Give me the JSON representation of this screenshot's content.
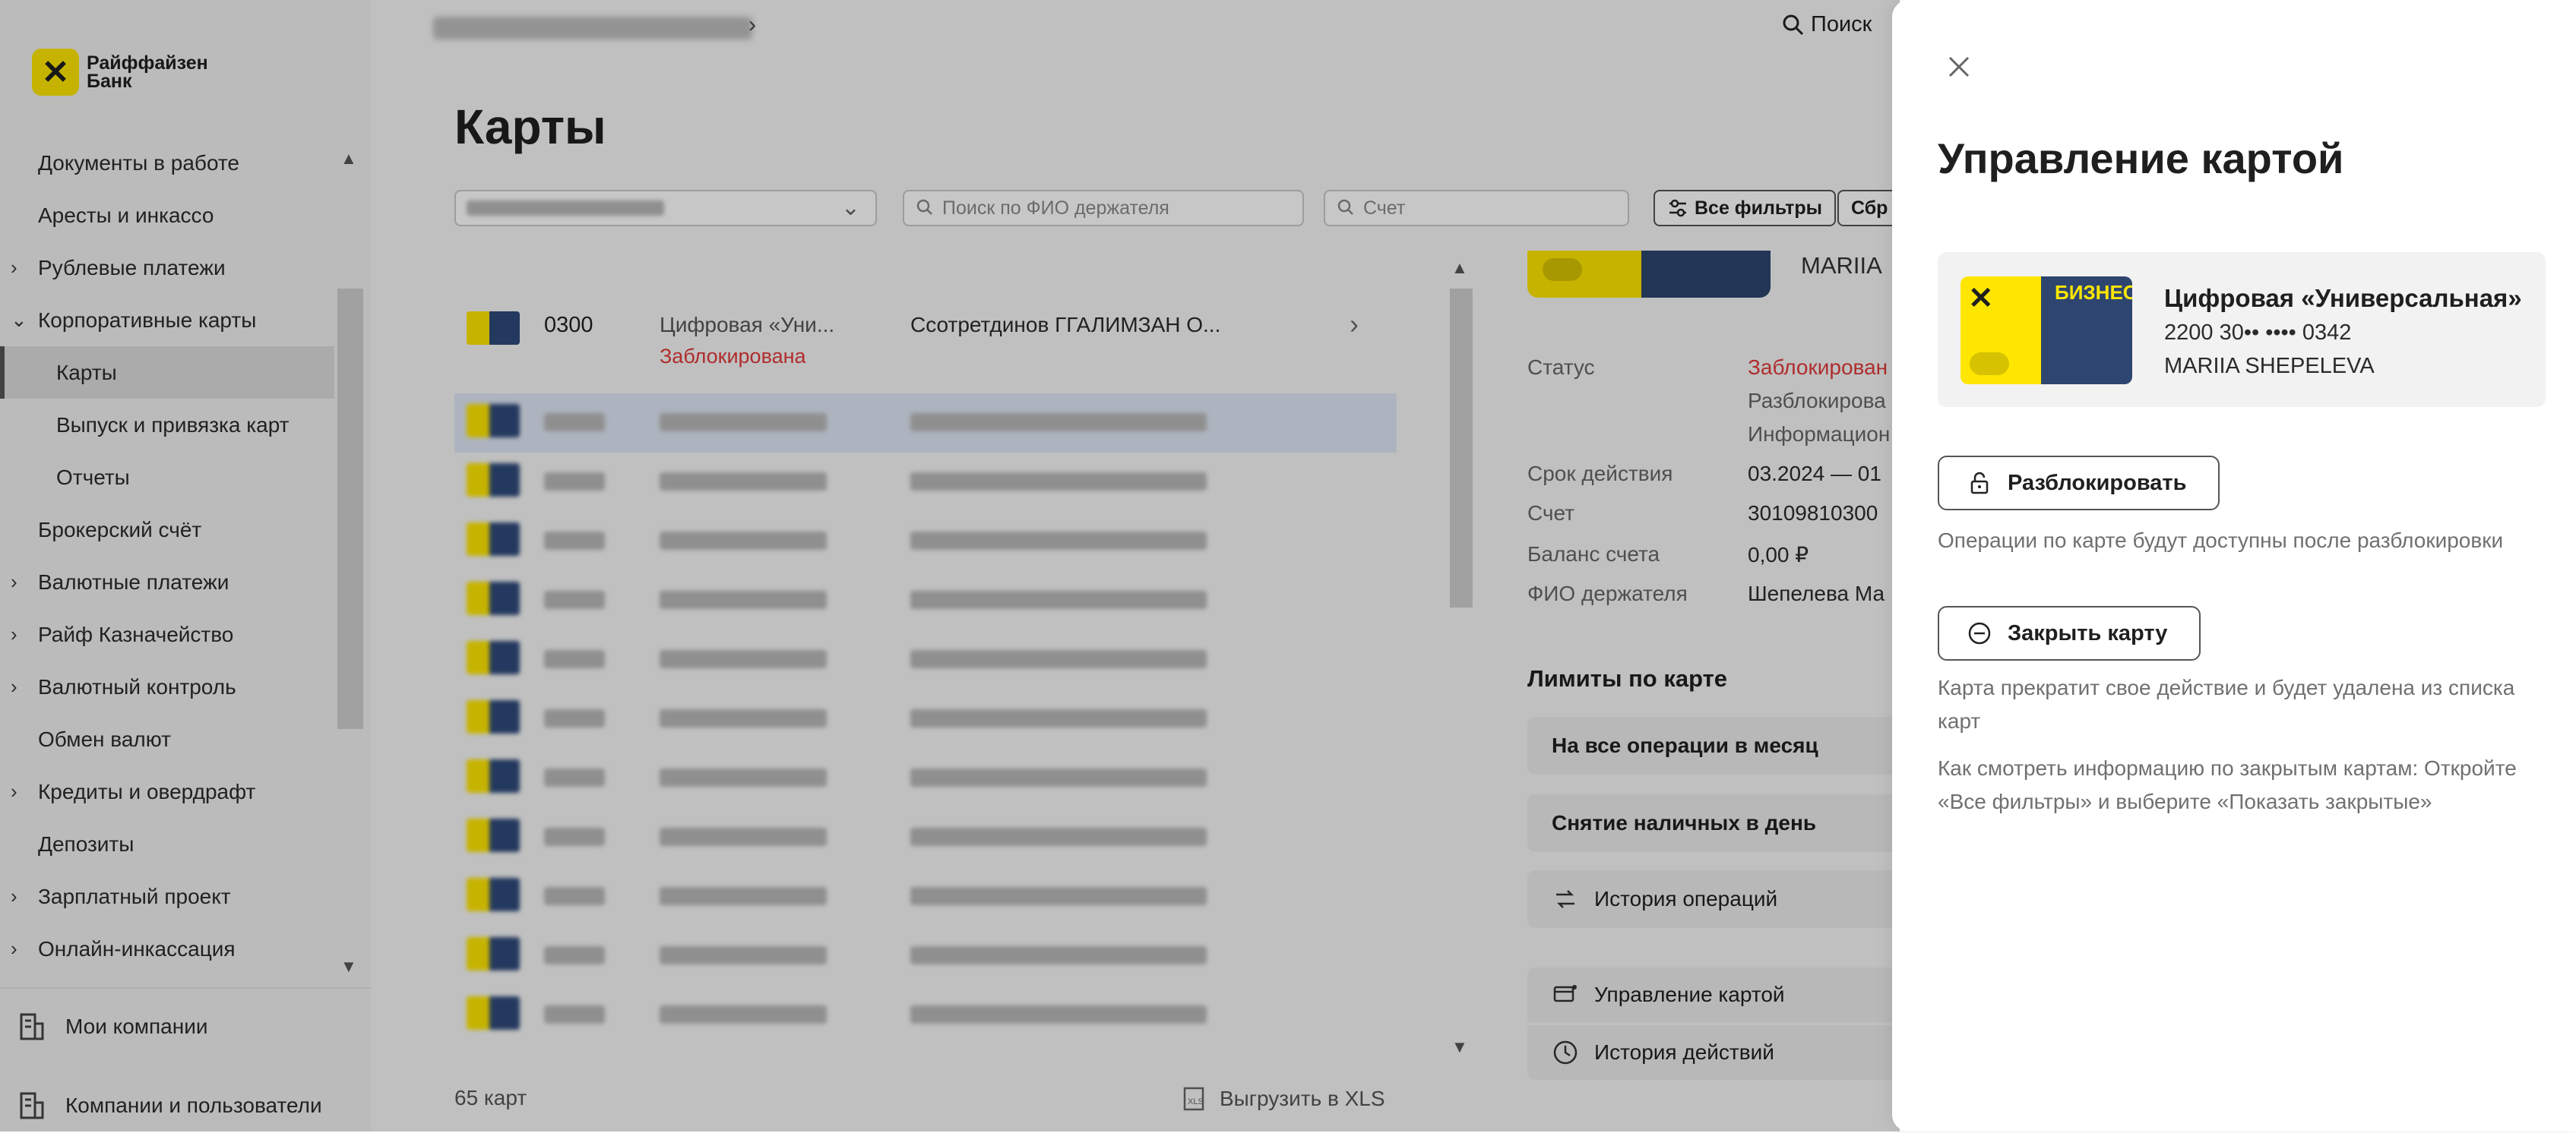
{
  "sidebar": {
    "logo_text": "Райффайзен Банк",
    "items": [
      {
        "label": "Документы в работе",
        "chevron": ""
      },
      {
        "label": "Аресты и инкассо",
        "chevron": ""
      },
      {
        "label": "Рублевые платежи",
        "chevron": "›"
      },
      {
        "label": "Корпоративные карты",
        "chevron": "⌄"
      },
      {
        "label": "Карты",
        "chevron": ""
      },
      {
        "label": "Выпуск и привязка карт",
        "chevron": ""
      },
      {
        "label": "Отчеты",
        "chevron": ""
      },
      {
        "label": "Брокерский счёт",
        "chevron": ""
      },
      {
        "label": "Валютные платежи",
        "chevron": "›"
      },
      {
        "label": "Райф Казначейство",
        "chevron": "›"
      },
      {
        "label": "Валютный контроль",
        "chevron": "›"
      },
      {
        "label": "Обмен валют",
        "chevron": ""
      },
      {
        "label": "Кредиты и овердрафт",
        "chevron": "›"
      },
      {
        "label": "Депозиты",
        "chevron": ""
      },
      {
        "label": "Зарплатный проект",
        "chevron": "›"
      },
      {
        "label": "Онлайн-инкассация",
        "chevron": "›"
      }
    ],
    "bottom": {
      "companies": "Мои компании",
      "users": "Компании и пользователи"
    }
  },
  "header": {
    "search_label": "Поиск"
  },
  "page": {
    "title": "Карты",
    "filters": {
      "holder_placeholder": "Поиск по ФИО держателя",
      "account_placeholder": "Счет",
      "all_filters": "Все фильтры",
      "reset": "Сбр"
    },
    "first_row": {
      "num": "0300",
      "name": "Цифровая «Уни...",
      "status": "Заблокирована",
      "holder": "Ссотретдинов ГГАЛИМЗАН О..."
    },
    "footer_count": "65 карт",
    "export_label": "Выгрузить в XLS"
  },
  "detail": {
    "holder_name": "MARIIA",
    "rows": [
      {
        "label": "Статус",
        "value": "Заблокирован"
      },
      {
        "label": "",
        "value": "Разблокирова"
      },
      {
        "label": "",
        "value": "Информацион"
      },
      {
        "label": "Срок действия",
        "value": "03.2024 — 01"
      },
      {
        "label": "Счет",
        "value": "30109810300"
      },
      {
        "label": "Баланс счета",
        "value": "0,00 ₽"
      },
      {
        "label": "ФИО держателя",
        "value": "Шепелева Ма"
      }
    ],
    "limits_title": "Лимиты по карте",
    "limits": [
      "На все операции в месяц",
      "Снятие наличных в день"
    ],
    "history": "История операций",
    "manage": "Управление картой",
    "actions_history": "История действий"
  },
  "drawer": {
    "title": "Управление картой",
    "card": {
      "title": "Цифровая «Универсальная»",
      "number": "2200 30•• •••• 0342",
      "holder": "MARIIA SHEPELEVA",
      "badge": "БИЗНЕС"
    },
    "unblock_label": "Разблокировать",
    "unblock_hint": "Операции по карте будут доступны после разблокировки",
    "close_card_label": "Закрыть карту",
    "close_hint": "Карта прекратит свое действие и будет удалена из списка карт",
    "closed_info": "Как смотреть информацию по закрытым картам: Откройте «Все фильтры» и выберите «Показать закрытые»"
  },
  "colors": {
    "brand_yellow": "#fee600",
    "blocked_red": "#e03a3a",
    "card_blue": "#2e466f"
  }
}
